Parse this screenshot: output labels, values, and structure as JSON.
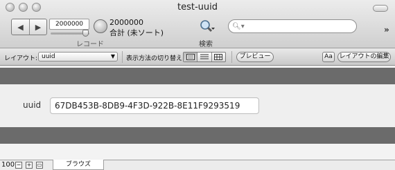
{
  "window": {
    "title": "test-uuid"
  },
  "toolbar": {
    "record_number": "2000000",
    "record_caption": "レコード",
    "found_count": "2000000",
    "found_label": "合計 (未ソート)",
    "find_label": "検索",
    "quick_find_placeholder": "",
    "overflow_icon": "double-chevron-right-icon"
  },
  "layout_bar": {
    "layout_label": "レイアウト:",
    "layout_value": "uuid",
    "view_as_label": "表示方法の切り替え:",
    "preview_button": "プレビュー",
    "aa_button": "Aa",
    "edit_layout_button": "レイアウトの編集"
  },
  "record": {
    "fields": [
      {
        "label": "uuid",
        "value": "67DB453B-8DB9-4F3D-922B-8E11F9293519"
      }
    ]
  },
  "status_bar": {
    "zoom": "100",
    "mode": "ブラウズ"
  }
}
